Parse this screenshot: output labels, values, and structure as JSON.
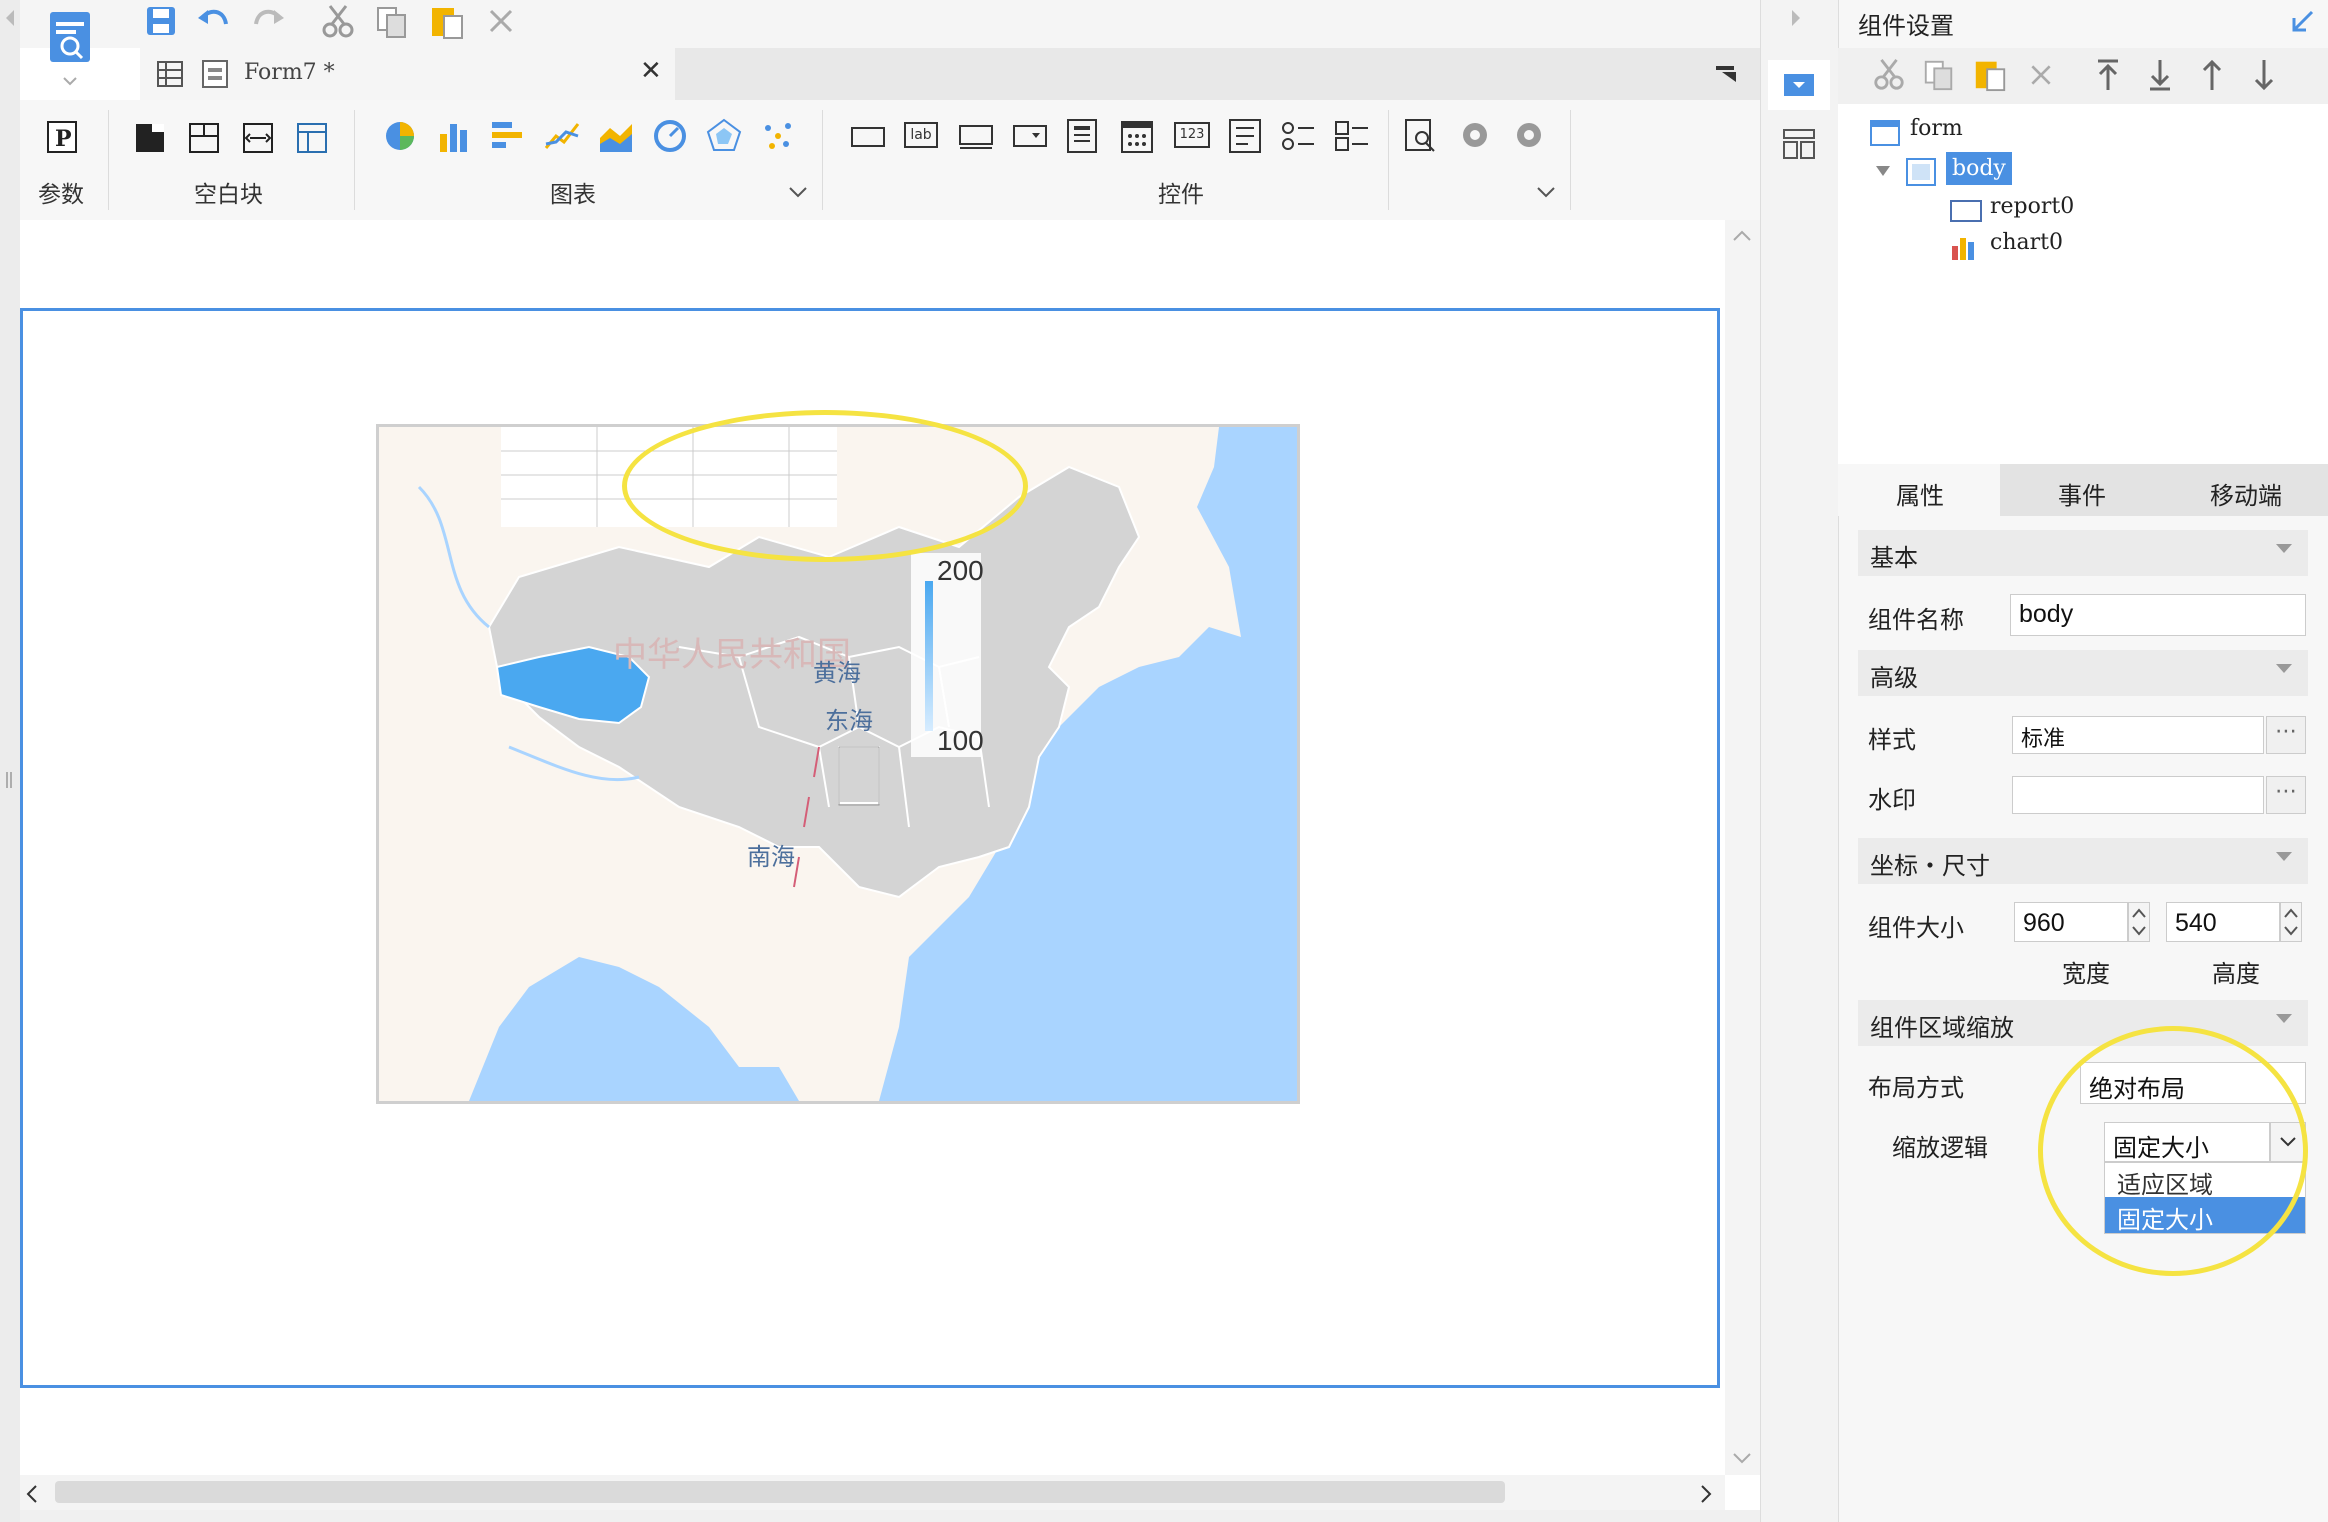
{
  "toolbar": {
    "doc_tab": "Form7 *",
    "groups": {
      "param": "参数",
      "blank": "空白块",
      "chart": "图表",
      "widget": "控件"
    },
    "widget_lab": "lab",
    "widget_123": "123"
  },
  "chart": {
    "watermark": "中华人民共和国",
    "sea_yellow": "黄海",
    "sea_east": "东海",
    "sea_south": "南海",
    "legend_max": "200",
    "legend_min": "100",
    "highlight_color": "#4aa8f0",
    "ocean_color": "#a9d4ff",
    "land_color": "#d4d4d4"
  },
  "panel": {
    "title": "组件设置",
    "tree": [
      {
        "label": "form"
      },
      {
        "label": "body",
        "selected": true
      },
      {
        "label": "report0"
      },
      {
        "label": "chart0"
      }
    ],
    "tabs": [
      "属性",
      "事件",
      "移动端"
    ],
    "sections": {
      "basic": "基本",
      "advanced": "高级",
      "coords": "坐标・尺寸",
      "zoom": "组件区域缩放"
    },
    "fields": {
      "name_label": "组件名称",
      "name_value": "body",
      "style_label": "样式",
      "style_value": "标准",
      "watermark_label": "水印",
      "watermark_value": "",
      "size_label": "组件大小",
      "width_value": "960",
      "height_value": "540",
      "width_label": "宽度",
      "height_label": "高度",
      "layout_label": "布局方式",
      "layout_value": "绝对布局",
      "scale_label": "缩放逻辑",
      "scale_value": "固定大小",
      "scale_options": [
        "适应区域",
        "固定大小"
      ]
    }
  },
  "accent_color": "#4a90e2"
}
